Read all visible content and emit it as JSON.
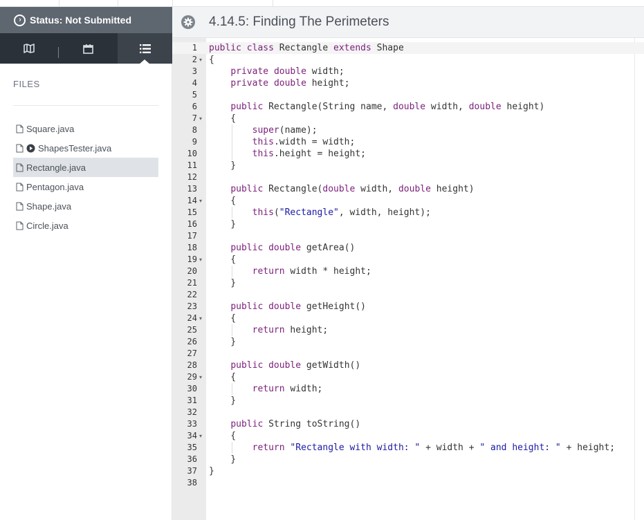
{
  "status": {
    "label": "Status: Not Submitted"
  },
  "nav": {
    "items": [
      "map-icon",
      "calendar-icon",
      "list-icon"
    ],
    "active_index": 2
  },
  "files": {
    "heading": "FILES",
    "items": [
      {
        "name": "Square.java",
        "runnable": false,
        "selected": false
      },
      {
        "name": "ShapesTester.java",
        "runnable": true,
        "selected": false
      },
      {
        "name": "Rectangle.java",
        "runnable": false,
        "selected": true
      },
      {
        "name": "Pentagon.java",
        "runnable": false,
        "selected": false
      },
      {
        "name": "Shape.java",
        "runnable": false,
        "selected": false
      },
      {
        "name": "Circle.java",
        "runnable": false,
        "selected": false
      }
    ]
  },
  "editor": {
    "title": "4.14.5: Finding The Perimeters",
    "language": "java",
    "keywords": [
      "public",
      "class",
      "extends",
      "private",
      "double",
      "super",
      "this",
      "return"
    ],
    "fold_lines": [
      2,
      7,
      14,
      19,
      24,
      29,
      34
    ],
    "active_line": 1,
    "lines": [
      "public class Rectangle extends Shape",
      "{",
      "    private double width;",
      "    private double height;",
      "",
      "    public Rectangle(String name, double width, double height)",
      "    {",
      "        super(name);",
      "        this.width = width;",
      "        this.height = height;",
      "    }",
      "",
      "    public Rectangle(double width, double height)",
      "    {",
      "        this(\"Rectangle\", width, height);",
      "    }",
      "",
      "    public double getArea()",
      "    {",
      "        return width * height;",
      "    }",
      "",
      "    public double getHeight()",
      "    {",
      "        return height;",
      "    }",
      "",
      "    public double getWidth()",
      "    {",
      "        return width;",
      "    }",
      "",
      "    public String toString()",
      "    {",
      "        return \"Rectangle with width: \" + width + \" and height: \" + height;",
      "    }",
      "}",
      ""
    ]
  },
  "colors": {
    "status_bg": "#5e6670",
    "nav_bg": "#2b3138",
    "keyword": "#7b1f7a",
    "string": "#1a1aa6",
    "selected_file_bg": "#dfe3e8"
  }
}
